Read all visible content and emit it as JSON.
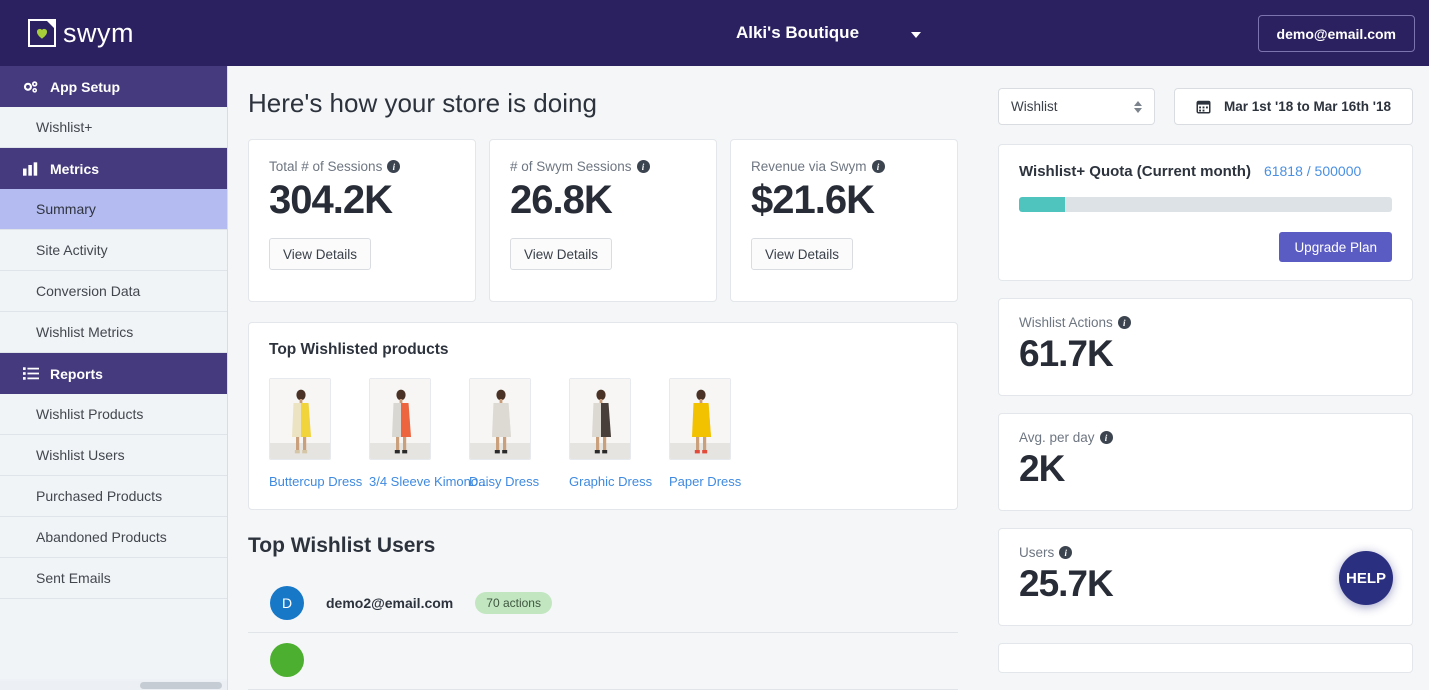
{
  "topbar": {
    "logo_text": "swym",
    "store_name": "Alki's Boutique",
    "account_label": "demo@email.com"
  },
  "sidebar": {
    "groups": [
      {
        "icon": "gears-icon",
        "label": "App Setup",
        "items": [
          {
            "label": "Wishlist+",
            "active": false
          }
        ]
      },
      {
        "icon": "bar-chart-icon",
        "label": "Metrics",
        "items": [
          {
            "label": "Summary",
            "active": true
          },
          {
            "label": "Site Activity",
            "active": false
          },
          {
            "label": "Conversion Data",
            "active": false
          },
          {
            "label": "Wishlist Metrics",
            "active": false
          }
        ]
      },
      {
        "icon": "list-icon",
        "label": "Reports",
        "items": [
          {
            "label": "Wishlist Products",
            "active": false
          },
          {
            "label": "Wishlist Users",
            "active": false
          },
          {
            "label": "Purchased Products",
            "active": false
          },
          {
            "label": "Abandoned Products",
            "active": false
          },
          {
            "label": "Sent Emails",
            "active": false
          }
        ]
      }
    ]
  },
  "main": {
    "page_title": "Here's how your store is doing",
    "stats": [
      {
        "label": "Total # of Sessions",
        "value": "304.2K",
        "button": "View Details"
      },
      {
        "label": "# of Swym Sessions",
        "value": "26.8K",
        "button": "View Details"
      },
      {
        "label": "Revenue via Swym",
        "value": "$21.6K",
        "button": "View Details"
      }
    ],
    "products_panel": {
      "title": "Top Wishlisted products",
      "products": [
        {
          "name": "Buttercup Dress"
        },
        {
          "name": "3/4 Sleeve Kimono..."
        },
        {
          "name": "Daisy Dress"
        },
        {
          "name": "Graphic Dress"
        },
        {
          "name": "Paper Dress"
        }
      ]
    },
    "users_section": {
      "title": "Top Wishlist Users",
      "users": [
        {
          "initial": "D",
          "email": "demo2@email.com",
          "badge": "70 actions",
          "color": "#1878c8"
        },
        {
          "initial": "",
          "email": "",
          "badge": "",
          "color": "#4caf2f"
        }
      ]
    }
  },
  "rail": {
    "select_value": "Wishlist",
    "date_range": "Mar 1st '18 to Mar 16th '18",
    "quota": {
      "title": "Wishlist+ Quota (Current month)",
      "count": "61818 / 500000",
      "percent": 12.4,
      "upgrade_label": "Upgrade Plan"
    },
    "metrics": [
      {
        "label": "Wishlist Actions",
        "value": "61.7K"
      },
      {
        "label": "Avg. per day",
        "value": "2K"
      },
      {
        "label": "Users",
        "value": "25.7K"
      }
    ],
    "help_label": "HELP"
  },
  "colors": {
    "topbar": "#2b2060",
    "nav_group": "#453a7d",
    "nav_active": "#b4bbf0",
    "accent_link": "#3f8ae0",
    "progress_fill": "#4fc3bd",
    "upgrade": "#5b5bc4",
    "badge": "#c2e6c0",
    "help": "#2b2f80",
    "logo_heart": "#a6ce39"
  }
}
